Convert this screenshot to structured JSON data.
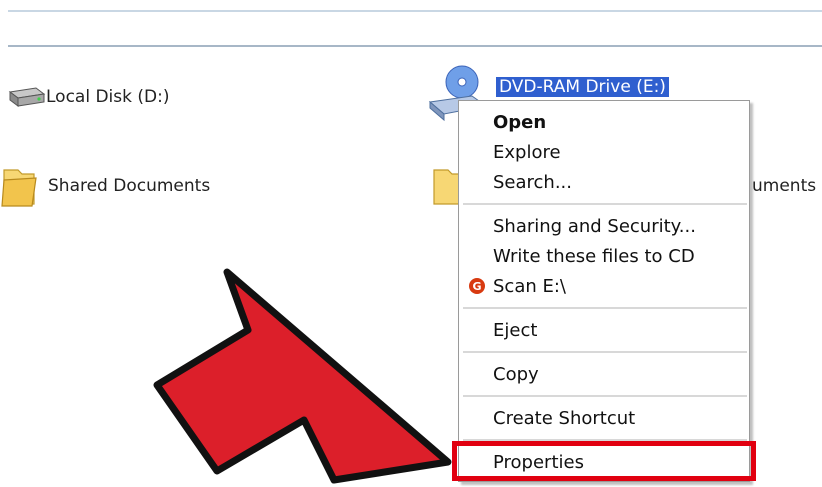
{
  "drives": [
    {
      "label": "Local Disk (D:)",
      "icon": "hard-disk-icon"
    },
    {
      "label": "DVD-RAM Drive (E:)",
      "icon": "dvd-drive-icon",
      "selected": true
    }
  ],
  "folders": [
    {
      "label": "Shared Documents",
      "icon": "folder-icon"
    },
    {
      "label": "uments",
      "icon": "folder-icon"
    }
  ],
  "context_menu": {
    "items": [
      {
        "label": "Open",
        "bold": true
      },
      {
        "label": "Explore"
      },
      {
        "label": "Search..."
      },
      {
        "label": "Sharing and Security..."
      },
      {
        "label": "Write these files to CD"
      },
      {
        "label": "Scan E:\\",
        "icon": "antivirus-icon"
      },
      {
        "label": "Eject"
      },
      {
        "label": "Copy"
      },
      {
        "label": "Create Shortcut"
      },
      {
        "label": "Properties",
        "highlighted": true
      }
    ]
  },
  "colors": {
    "selection": "#2f5fcf",
    "highlight_box": "#e10010",
    "arrow_fill": "#dc1f2a",
    "antivirus_red": "#d83a10"
  }
}
